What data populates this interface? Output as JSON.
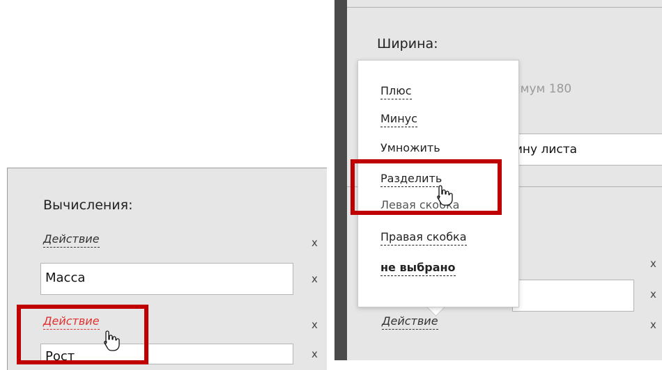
{
  "left_panel": {
    "title": "Вычисления:",
    "rows": [
      {
        "type": "action",
        "label": "Действие",
        "remove": "x"
      },
      {
        "type": "input",
        "value": "Масса",
        "remove": "x"
      },
      {
        "type": "action",
        "label": "Действие",
        "remove": "x",
        "state": "hover"
      },
      {
        "type": "input",
        "value": "Рост",
        "remove": "x"
      }
    ]
  },
  "right_panel": {
    "title": "Ширина:",
    "hint_partial": "ксимум 180",
    "input_partial": "ирину листа",
    "lower_action_label": "Действие",
    "remove_labels": [
      "x",
      "x",
      "x"
    ]
  },
  "action_menu": {
    "items": [
      {
        "label": "Плюс"
      },
      {
        "label": "Минус"
      },
      {
        "label": "Умножить"
      },
      {
        "label": "Разделить",
        "state": "hover"
      },
      {
        "label": "Левая скобка"
      },
      {
        "label": "Правая скобка"
      },
      {
        "label": "не выбрано",
        "bold": true
      }
    ]
  },
  "colors": {
    "highlight": "#c00000",
    "hover_link": "#e03030",
    "panel_bg": "#e6e6e6"
  },
  "icons": {
    "cursor": "hand-pointer-icon"
  }
}
